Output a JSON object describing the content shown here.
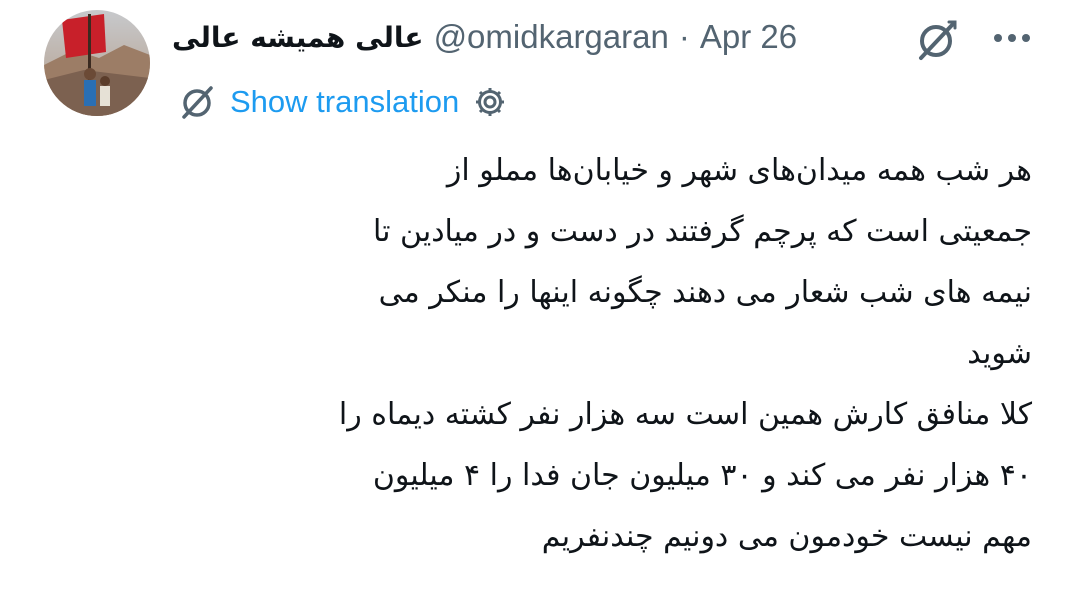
{
  "tweet": {
    "display_name": "عالی همیشه عالی",
    "handle": "@omidkargaran",
    "separator": "·",
    "date": "Apr 26",
    "show_translation": "Show translation",
    "lines": [
      "هر شب همه میدان‌های شهر و خیابان‌ها مملو از",
      "جمعیتی است که پرچم گرفتند در دست و در میادین تا",
      "نیمه های شب شعار می دهند چگونه اینها را منکر می",
      "شوید",
      "کلا منافق کارش همین است سه هزار نفر کشته دیماه را",
      "۴۰ هزار نفر می کند و ۳۰ میلیون جان فدا را ۴ میلیون",
      "مهم نیست خودمون می دونیم چندنفریم"
    ]
  },
  "icons": {
    "grok": "grok-icon",
    "more": "more-icon",
    "translate": "translate-slash-icon",
    "settings": "settings-gear-icon"
  },
  "colors": {
    "link": "#1d9bf0",
    "secondary": "#536471",
    "text": "#0f1419"
  }
}
